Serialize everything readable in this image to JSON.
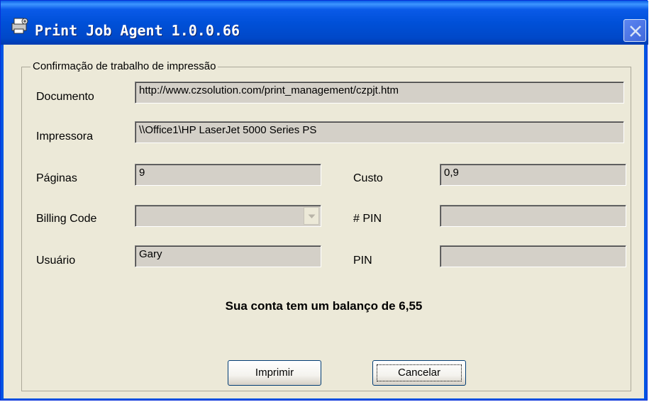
{
  "window": {
    "title": "Print Job Agent 1.0.0.66",
    "icon": "printer-agent-icon",
    "close_icon": "close-icon"
  },
  "group": {
    "label": "Confirmação de trabalho de impressão"
  },
  "fields": {
    "documento": {
      "label": "Documento",
      "value": "http://www.czsolution.com/print_management/czpjt.htm"
    },
    "impressora": {
      "label": "Impressora",
      "value": "\\\\Office1\\HP LaserJet 5000 Series PS"
    },
    "paginas": {
      "label": "Páginas",
      "value": "9"
    },
    "custo": {
      "label": "Custo",
      "value": "0,9"
    },
    "billing_code": {
      "label": "Billing Code",
      "value": ""
    },
    "pin_number": {
      "label": "# PIN",
      "value": ""
    },
    "usuario": {
      "label": "Usuário",
      "value": "Gary"
    },
    "pin": {
      "label": "PIN",
      "value": ""
    }
  },
  "balance_message": "Sua conta tem um balanço de 6,55",
  "buttons": {
    "print": "Imprimir",
    "cancel": "Cancelar"
  },
  "colors": {
    "titlebar": "#0054e3",
    "dialog_bg": "#ece9d8",
    "field_bg": "#d4d0c8"
  }
}
